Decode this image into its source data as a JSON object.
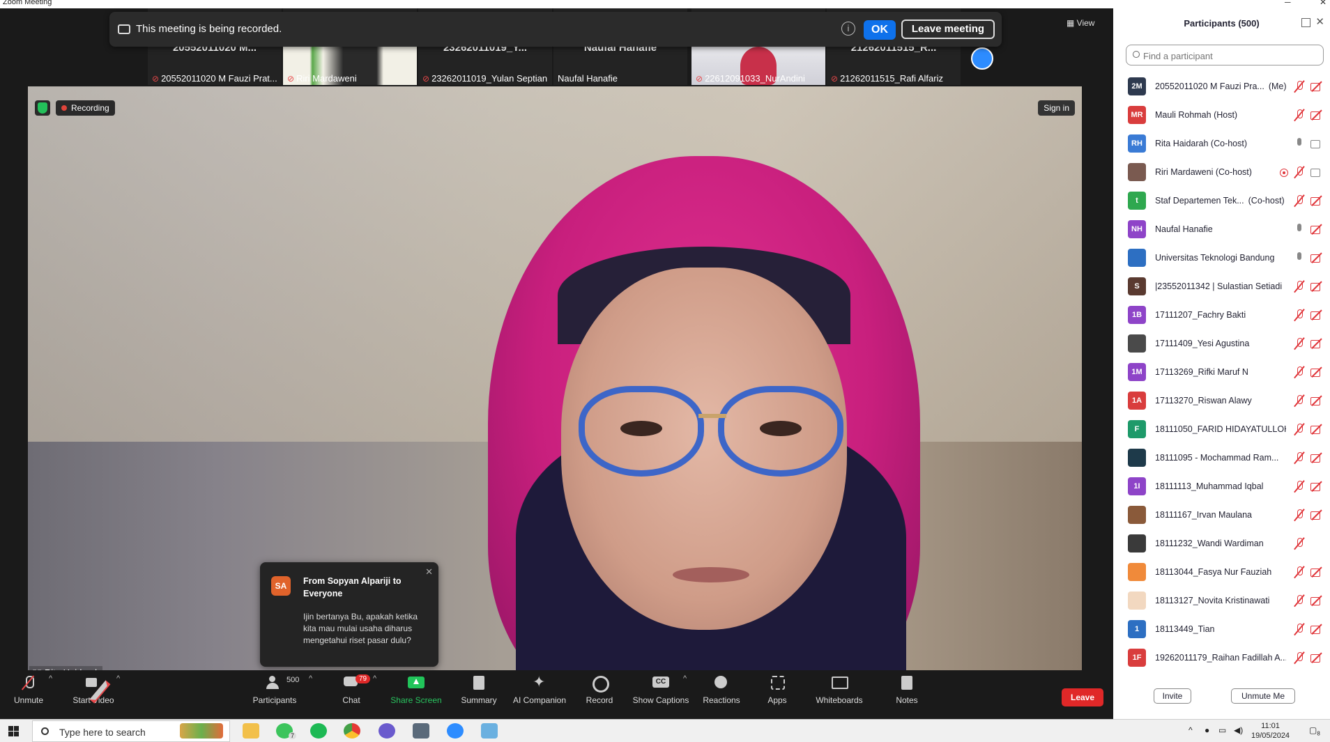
{
  "window": {
    "title": "Zoom Meeting"
  },
  "banner": {
    "text": "This meeting is being recorded.",
    "ok_label": "OK",
    "leave_label": "Leave meeting"
  },
  "view_label": "View",
  "thumbnails": [
    {
      "big": "20552011020 M...",
      "name": "20552011020 M Fauzi Prat..."
    },
    {
      "big": "",
      "name": "Riri Mardaweni"
    },
    {
      "big": "23262011019_Y...",
      "name": "23262011019_Yulan Septian"
    },
    {
      "big": "Naufal Hanafie",
      "name": "Naufal Hanafie"
    },
    {
      "big": "",
      "name": "22612091033_NurAndini"
    },
    {
      "big": "21262011515_R...",
      "name": "21262011515_Rafi Alfariz"
    }
  ],
  "video": {
    "recording_label": "Recording",
    "signin_label": "Sign in",
    "speaker_name": "Rita Haidarah"
  },
  "chat_popup": {
    "avatar": "SA",
    "from": "From Sopyan Alpariji to Everyone",
    "message": "Ijin bertanya Bu, apakah ketika kita mau mulai usaha diharus mengetahui riset pasar dulu?"
  },
  "toolbar": {
    "unmute": "Unmute",
    "start_video": "Start Video",
    "participants_count": "500",
    "participants": "Participants",
    "chat_badge": "79",
    "chat": "Chat",
    "share_screen": "Share Screen",
    "summary": "Summary",
    "ai_companion": "AI Companion",
    "record": "Record",
    "show_captions": "Show Captions",
    "reactions": "Reactions",
    "apps": "Apps",
    "whiteboards": "Whiteboards",
    "notes": "Notes",
    "leave": "Leave"
  },
  "panel": {
    "title": "Participants (500)",
    "search_placeholder": "Find a participant",
    "invite": "Invite",
    "unmute_me": "Unmute Me",
    "participants": [
      {
        "initials": "2M",
        "color": "#2e3a4f",
        "name": "20552011020 M Fauzi Pra...",
        "role": "(Me)",
        "mic": "off",
        "video": "off"
      },
      {
        "initials": "MR",
        "color": "#d93d3d",
        "name": "Mauli Rohmah (Host)",
        "role": "",
        "mic": "off",
        "video": "off"
      },
      {
        "initials": "RH",
        "color": "#3a7bd5",
        "name": "Rita Haidarah (Co-host)",
        "role": "",
        "mic": "on",
        "video": "on"
      },
      {
        "initials": "",
        "color": "#7a5a50",
        "name": "Riri Mardaweni (Co-host)",
        "role": "",
        "mic": "rec",
        "video": "on",
        "mic2": "off"
      },
      {
        "initials": "t",
        "color": "#2fa84f",
        "name": "Staf Departemen Tek...",
        "role": "(Co-host)",
        "mic": "off",
        "video": "off"
      },
      {
        "initials": "NH",
        "color": "#8e44c8",
        "name": "Naufal Hanafie",
        "role": "",
        "mic": "on",
        "video": "off"
      },
      {
        "initials": "",
        "color": "#2d6fc2",
        "name": "Universitas Teknologi Bandung",
        "role": "",
        "mic": "on",
        "video": "off"
      },
      {
        "initials": "S",
        "color": "#5a3a30",
        "name": "|23552011342 | Sulastian Setiadi",
        "role": "",
        "mic": "off",
        "video": "off"
      },
      {
        "initials": "1B",
        "color": "#8e44c8",
        "name": "17111207_Fachry Bakti",
        "role": "",
        "mic": "off",
        "video": "off"
      },
      {
        "initials": "",
        "color": "#4a4a4a",
        "name": "17111409_Yesi Agustina",
        "role": "",
        "mic": "off",
        "video": "off"
      },
      {
        "initials": "1M",
        "color": "#8e44c8",
        "name": "17113269_Rifki Maruf N",
        "role": "",
        "mic": "off",
        "video": "off"
      },
      {
        "initials": "1A",
        "color": "#d93d3d",
        "name": "17113270_Riswan Alawy",
        "role": "",
        "mic": "off",
        "video": "off"
      },
      {
        "initials": "F",
        "color": "#1e9a6a",
        "name": "18111050_FARID HIDAYATULLOH",
        "role": "",
        "mic": "off",
        "video": "off"
      },
      {
        "initials": "",
        "color": "#1e3a4a",
        "name": "18111095 - Mochammad Ram...",
        "role": "",
        "mic": "off",
        "video": "off"
      },
      {
        "initials": "1I",
        "color": "#8e44c8",
        "name": "18111113_Muhammad Iqbal",
        "role": "",
        "mic": "off",
        "video": "off"
      },
      {
        "initials": "",
        "color": "#8a5a3a",
        "name": "18111167_Irvan Maulana",
        "role": "",
        "mic": "off",
        "video": "off"
      },
      {
        "initials": "",
        "color": "#3a3a3a",
        "name": "18111232_Wandi Wardiman",
        "role": "",
        "mic": "off",
        "video": "none"
      },
      {
        "initials": "",
        "color": "#f08a3a",
        "name": "18113044_Fasya Nur Fauziah",
        "role": "",
        "mic": "off",
        "video": "off"
      },
      {
        "initials": "",
        "color": "#f2d8c0",
        "name": "18113127_Novita Kristinawati",
        "role": "",
        "mic": "off",
        "video": "off"
      },
      {
        "initials": "1",
        "color": "#2d6fc2",
        "name": "18113449_Tian",
        "role": "",
        "mic": "off",
        "video": "off"
      },
      {
        "initials": "1F",
        "color": "#d93d3d",
        "name": "19262011179_Raihan Fadillah A...",
        "role": "",
        "mic": "off",
        "video": "off"
      }
    ]
  },
  "taskbar": {
    "search_placeholder": "Type here to search",
    "time": "11:01",
    "date": "19/05/2024",
    "whatsapp_badge": "7",
    "notif_count": "8"
  }
}
